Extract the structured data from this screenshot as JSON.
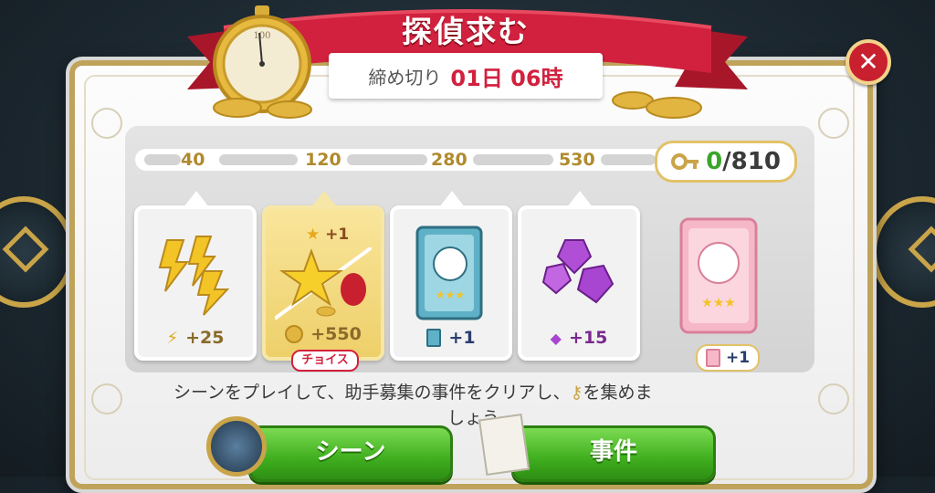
{
  "header": {
    "title": "探偵求む",
    "deadline_label": "締め切り",
    "deadline_value": "01日 06時"
  },
  "progress": {
    "milestones": [
      "40",
      "120",
      "280",
      "530"
    ],
    "current": "0",
    "separator": "/",
    "total": "810",
    "fill_fraction": 0
  },
  "rewards": [
    {
      "id": "energy",
      "amount": "+25",
      "icon": "lightning-icon"
    },
    {
      "id": "star-coins",
      "top_amount": "+1",
      "amount": "+550",
      "choice_label": "チョイス",
      "icon": "star-coin-pouch-icon"
    },
    {
      "id": "blue-book",
      "amount": "+1",
      "icon": "blue-casebook-icon"
    },
    {
      "id": "gems",
      "amount": "+15",
      "icon": "purple-gem-icon"
    },
    {
      "id": "pink-book",
      "amount": "+1",
      "icon": "pink-casebook-icon"
    }
  ],
  "instructions": {
    "before_key": "シーンをプレイして、助手募集の事件をクリアし、",
    "after_key": "を集めま",
    "line2": "しょう"
  },
  "buttons": {
    "scene_label": "シーン",
    "case_label": "事件"
  },
  "stopwatch": {
    "number": "100"
  },
  "colors": {
    "ribbon": "#d1213e",
    "gold": "#c9a448",
    "green_button": "#3fae1e",
    "progress_current": "#3ba52b"
  }
}
